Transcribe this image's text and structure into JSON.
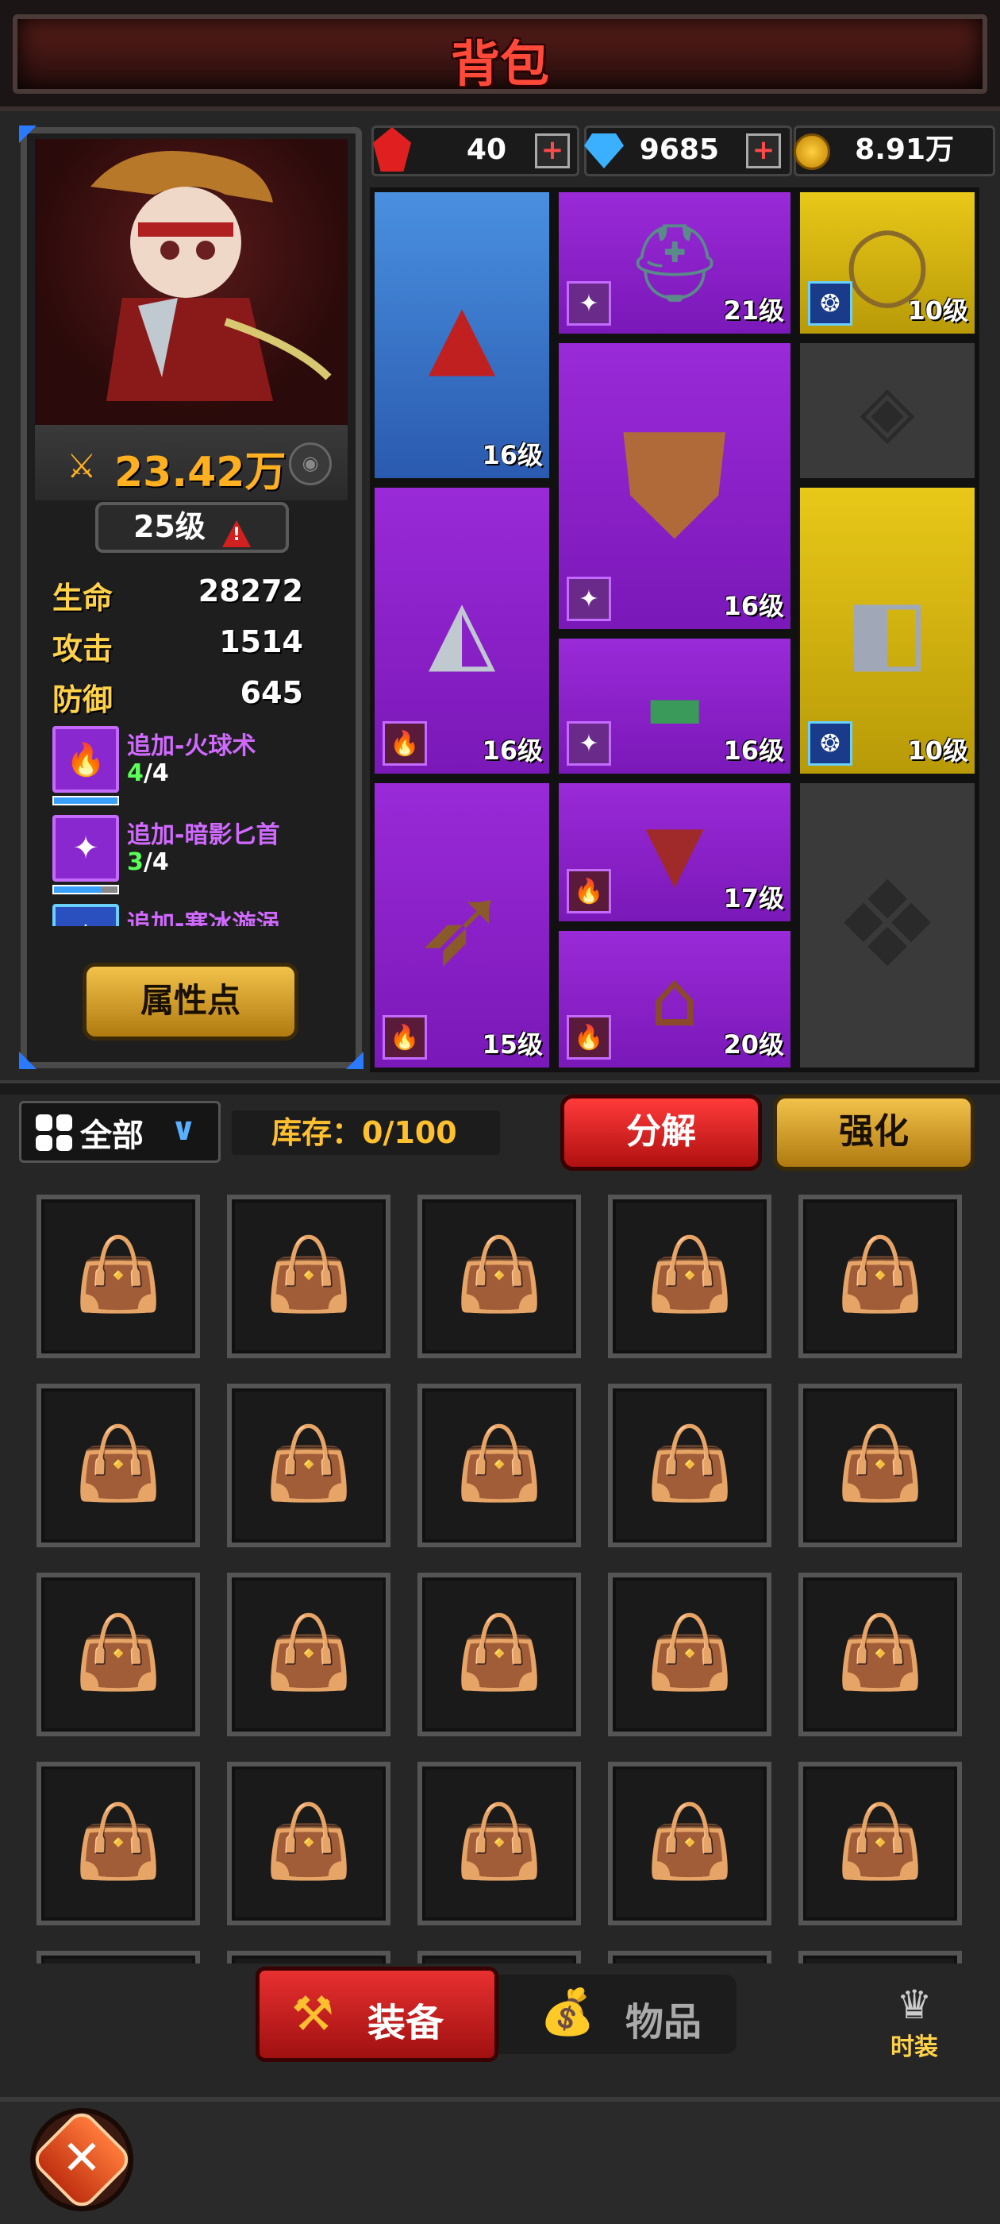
{
  "header": {
    "title": "背包"
  },
  "hero": {
    "power": "23.42万",
    "level": "25级",
    "stats": [
      {
        "label": "生命",
        "value": "28272"
      },
      {
        "label": "攻击",
        "value": "1514"
      },
      {
        "label": "防御",
        "value": "645"
      }
    ],
    "skills": [
      {
        "name": "追加-火球术",
        "current": "4",
        "total": "/4",
        "icon": "fireball-icon"
      },
      {
        "name": "追加-暗影匕首",
        "current": "3",
        "total": "/4",
        "icon": "shadow-dagger-icon"
      },
      {
        "name": "追加-寒冰漩涡",
        "current": "",
        "total": "",
        "icon": "ice-vortex-icon"
      }
    ],
    "attr_button": "属性点"
  },
  "resources": [
    {
      "icon": "red-crystal-icon",
      "value": "40",
      "has_plus": true
    },
    {
      "icon": "diamond-icon",
      "value": "9685",
      "has_plus": true
    },
    {
      "icon": "gold-coin-icon",
      "value": "8.91万",
      "has_plus": false
    }
  ],
  "equipment": {
    "hat": {
      "level": "16级",
      "rarity": "blue"
    },
    "helmet": {
      "level": "21级",
      "rarity": "purple"
    },
    "necklace": {
      "level": "10级",
      "rarity": "gold"
    },
    "ring": {
      "level": "",
      "rarity": "gray"
    },
    "armor": {
      "level": "16级",
      "rarity": "purple"
    },
    "shoulder": {
      "level": "16级",
      "rarity": "purple"
    },
    "bracer": {
      "level": "10级",
      "rarity": "gold"
    },
    "belt": {
      "level": "16级",
      "rarity": "purple"
    },
    "weapon": {
      "level": "15级",
      "rarity": "purple"
    },
    "cape": {
      "level": "17级",
      "rarity": "purple"
    },
    "boots": {
      "level": "20级",
      "rarity": "purple"
    },
    "empty": {
      "level": "",
      "rarity": "gray"
    }
  },
  "toolbar": {
    "filter": "全部",
    "stock": "库存：0/100",
    "decompose": "分解",
    "enhance": "强化"
  },
  "tabs": {
    "equip": "装备",
    "items": "物品",
    "costume": "时装"
  },
  "colors": {
    "accent_red": "#e83030",
    "gold": "#f2c24a",
    "purple": "#9a2ad8",
    "blue": "#4a90e0"
  }
}
